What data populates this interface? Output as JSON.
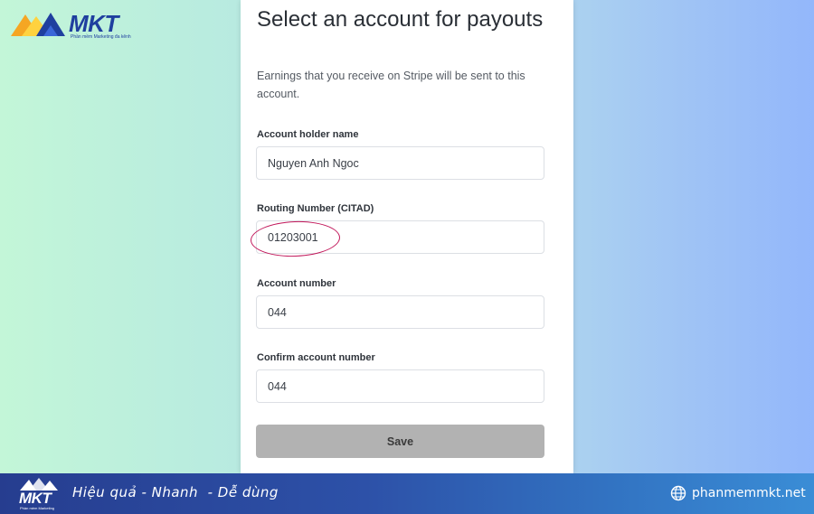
{
  "brand": {
    "logo_text": "MKT",
    "logo_tagline": "Phần mềm Marketing đa kênh",
    "colors": {
      "blue": "#1f3f9f",
      "orange": "#f5a623",
      "yellow": "#ffd23f"
    }
  },
  "form": {
    "title": "Select an account for payouts",
    "description": "Earnings that you receive on Stripe will be sent to this account.",
    "fields": [
      {
        "label": "Account holder name",
        "value": "Nguyen Anh Ngoc"
      },
      {
        "label": "Routing Number (CITAD)",
        "value": "01203001"
      },
      {
        "label": "Account number",
        "value": "044"
      },
      {
        "label": "Confirm account number",
        "value": "044"
      }
    ],
    "save_label": "Save",
    "highlight_color": "#c2185b"
  },
  "banner": {
    "logo_text": "MKT",
    "logo_tagline": "Phần mềm Marketing",
    "slogan": "Hiệu quả - Nhanh  - Dễ dùng",
    "website": "phanmemmkt.net",
    "globe_icon": "globe-icon"
  }
}
